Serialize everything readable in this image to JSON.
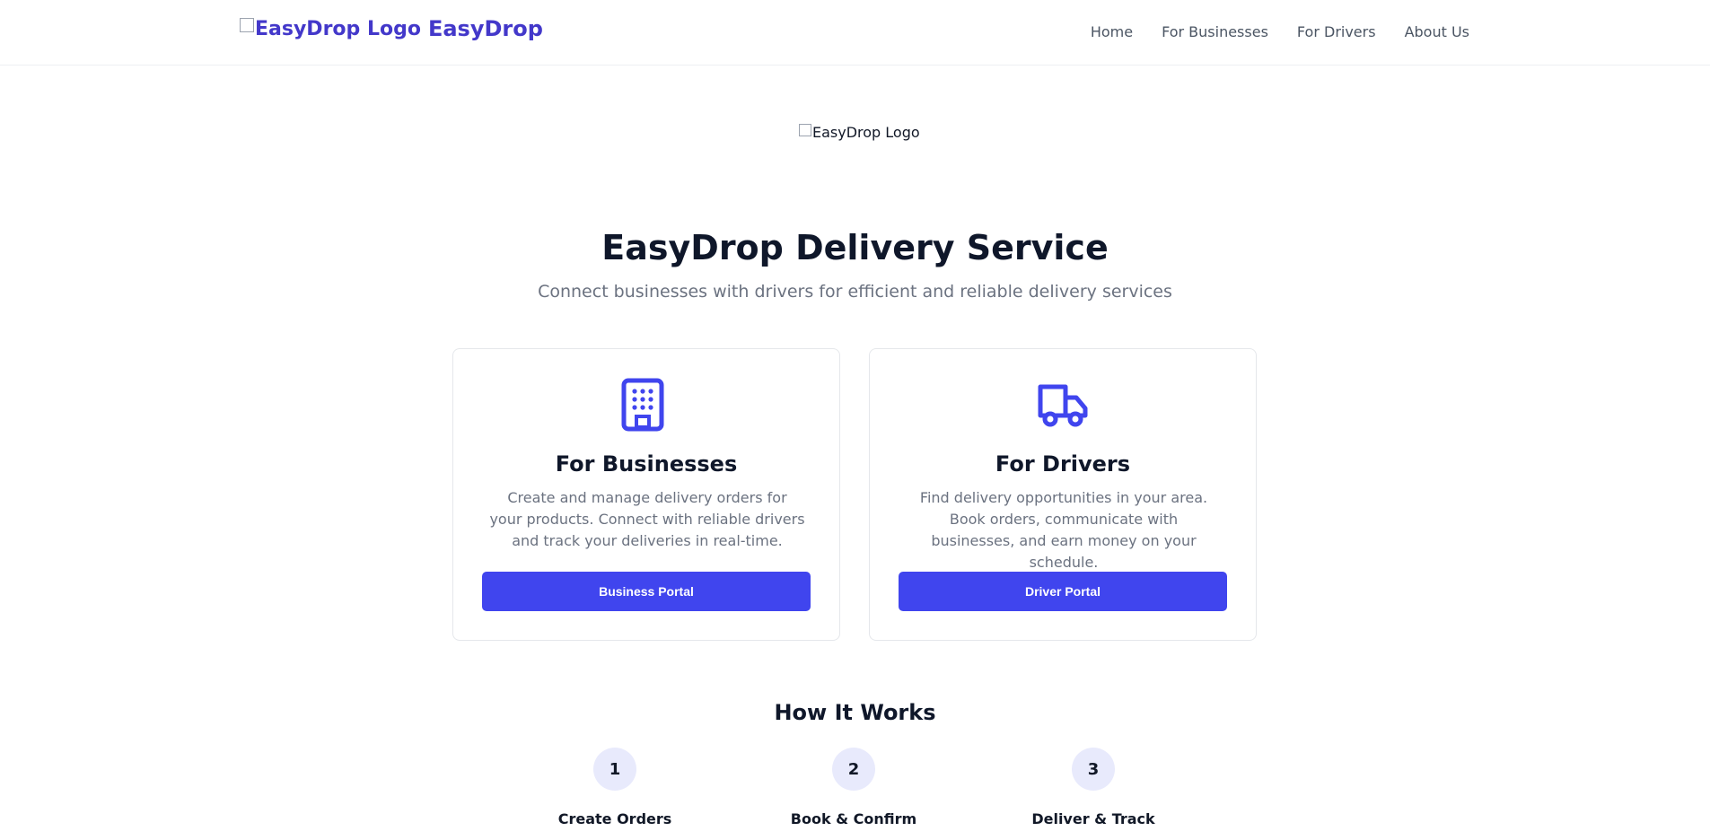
{
  "header": {
    "logo_alt": "EasyDrop Logo",
    "brand_name": "EasyDrop",
    "nav": [
      "Home",
      "For Businesses",
      "For Drivers",
      "About Us"
    ]
  },
  "hero": {
    "logo_alt": "EasyDrop Logo",
    "title": "EasyDrop Delivery Service",
    "subtitle": "Connect businesses with drivers for efficient and reliable delivery services"
  },
  "cards": {
    "business": {
      "icon": "building-icon",
      "title": "For Businesses",
      "description": "Create and manage delivery orders for your products. Connect with reliable drivers and track your deliveries in real-time.",
      "button": "Business Portal"
    },
    "driver": {
      "icon": "truck-icon",
      "title": "For Drivers",
      "description": "Find delivery opportunities in your area. Book orders, communicate with businesses, and earn money on your schedule.",
      "button": "Driver Portal"
    }
  },
  "how_it_works": {
    "title": "How It Works",
    "steps": [
      {
        "number": "1",
        "label": "Create Orders"
      },
      {
        "number": "2",
        "label": "Book & Confirm"
      },
      {
        "number": "3",
        "label": "Deliver & Track"
      }
    ]
  },
  "colors": {
    "accent": "#4045ee",
    "brand": "#4338ca",
    "step_circle": "#e8eafc"
  }
}
